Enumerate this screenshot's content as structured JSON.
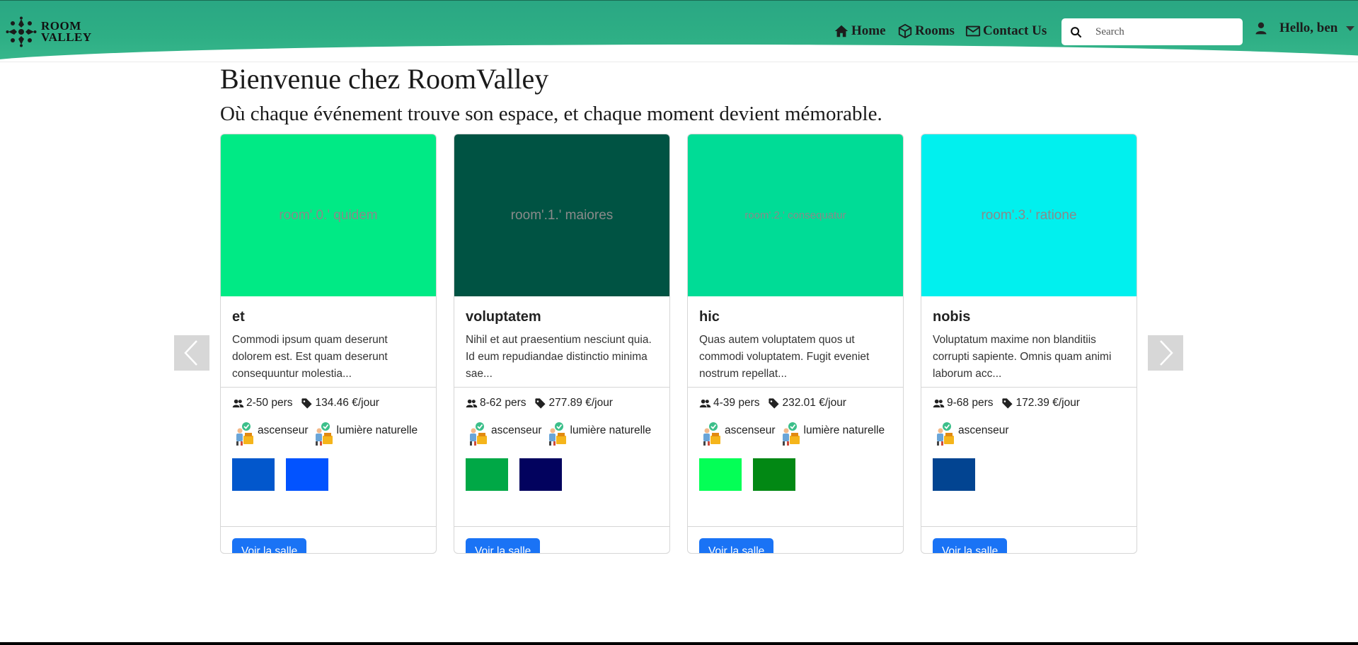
{
  "nav": {
    "logo_line1": "ROOM",
    "logo_line2": "VALLEY",
    "links": [
      {
        "label": "Home",
        "icon": "home-icon"
      },
      {
        "label": "Rooms",
        "icon": "cube-icon"
      },
      {
        "label": "Contact Us",
        "icon": "envelope-icon"
      }
    ],
    "search_placeholder": "Search",
    "user_greeting": "Hello, ben"
  },
  "main": {
    "title": "Bienvenue chez RoomValley",
    "subtitle": "Où chaque événement trouve son espace, et chaque moment devient mémorable."
  },
  "cards": [
    {
      "image_text": "room'.0.' quidem",
      "image_color": "#00ea85",
      "title": "et",
      "description": "Commodi ipsum quam deserunt dolorem est. Est quam deserunt consequuntur molestia...",
      "capacity": "2-50 pers",
      "price": "134.46 €/jour",
      "features": [
        "ascenseur",
        "lumière naturelle"
      ],
      "thumb_colors": [
        "#0257cc",
        "#0253ff"
      ],
      "button": "Voir la salle"
    },
    {
      "image_text": "room'.1.' maiores",
      "image_color": "#005343",
      "title": "voluptatem",
      "description": "Nihil et aut praesentium nesciunt quia. Id eum repudiandae distinctio minima sae...",
      "capacity": "8-62 pers",
      "price": "277.89 €/jour",
      "features": [
        "ascenseur",
        "lumière naturelle"
      ],
      "thumb_colors": [
        "#00a846",
        "#02025e"
      ],
      "button": "Voir la salle"
    },
    {
      "image_text": "room'.2.' consequatur",
      "image_color": "#00dc96",
      "title": "hic",
      "description": "Quas autem voluptatem quos ut commodi voluptatem. Fugit eveniet nostrum repellat...",
      "capacity": "4-39 pers",
      "price": "232.01 €/jour",
      "features": [
        "ascenseur",
        "lumière naturelle"
      ],
      "thumb_colors": [
        "#04ff56",
        "#028814"
      ],
      "button": "Voir la salle"
    },
    {
      "image_text": "room'.3.' ratione",
      "image_color": "#01f0ee",
      "title": "nobis",
      "description": "Voluptatum maxime non blanditiis corrupti sapiente. Omnis quam animi laborum acc...",
      "capacity": "9-68 pers",
      "price": "172.39 €/jour",
      "features": [
        "ascenseur"
      ],
      "thumb_colors": [
        "#024491"
      ],
      "button": "Voir la salle"
    }
  ]
}
